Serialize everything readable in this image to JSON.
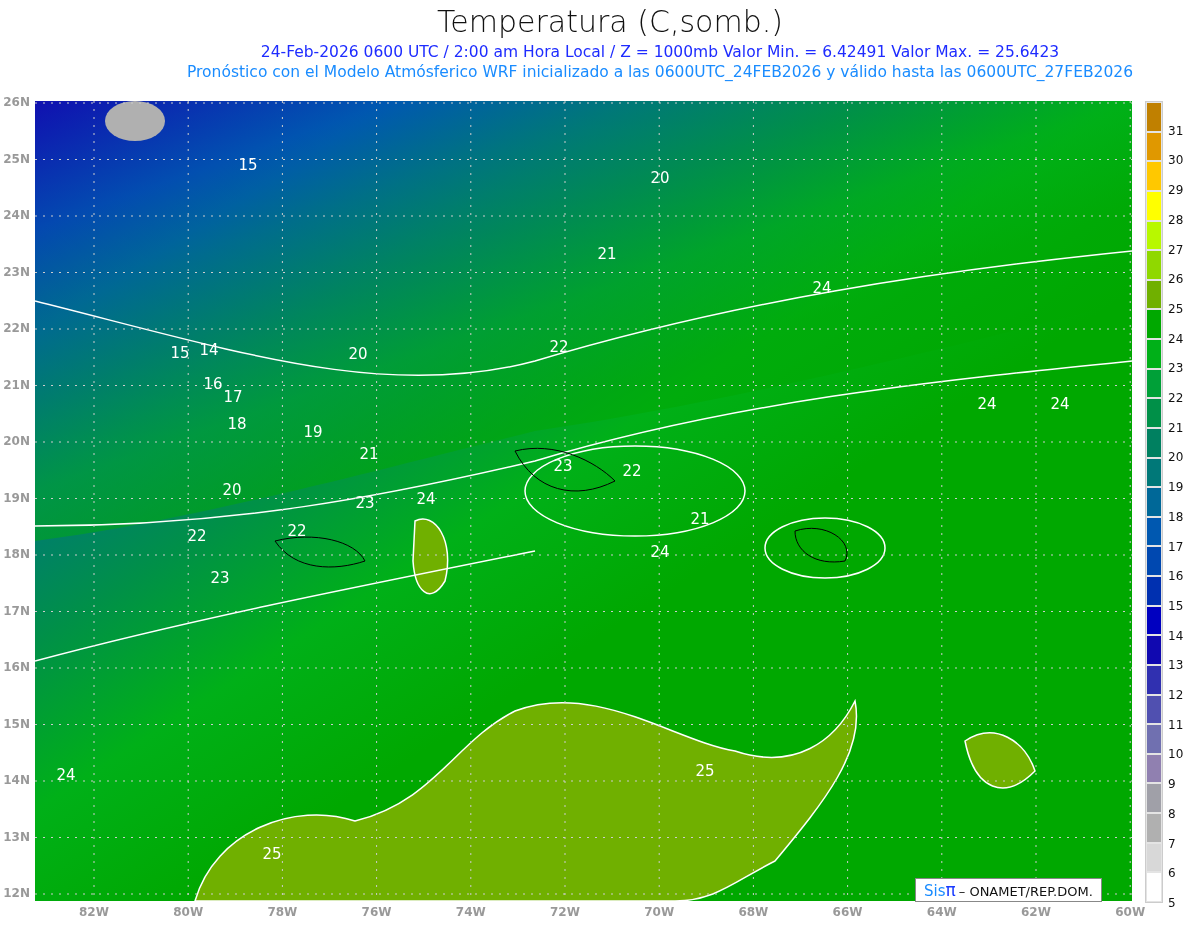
{
  "title": "Temperatura (C,somb.)",
  "subtitle": "24-Feb-2026  0600 UTC / 2:00 am Hora Local / Z = 1000mb   Valor Min. = 6.42491  Valor Max. = 25.6423",
  "forecast_note": "Pronóstico con el Modelo Atmósferico WRF inicializado a las 0600UTC_24FEB2026 y válido hasta las  0600UTC_27FEB2026",
  "latitude_labels": [
    "26N",
    "25N",
    "24N",
    "23N",
    "22N",
    "21N",
    "20N",
    "19N",
    "18N",
    "17N",
    "16N",
    "15N",
    "14N",
    "13N",
    "12N"
  ],
  "longitude_labels": [
    "82W",
    "80W",
    "78W",
    "76W",
    "74W",
    "72W",
    "70W",
    "68W",
    "66W",
    "64W",
    "62W",
    "60W"
  ],
  "contour_labels": [
    "15",
    "20",
    "21",
    "24",
    "15",
    "14",
    "20",
    "22",
    "16",
    "17",
    "18",
    "19",
    "21",
    "24",
    "24",
    "20",
    "23",
    "24",
    "23",
    "22",
    "21",
    "22",
    "22",
    "24",
    "23",
    "25",
    "24",
    "25"
  ],
  "colorbar": {
    "bins": [
      {
        "color": "#c08000"
      },
      {
        "color": "#e09800"
      },
      {
        "color": "#ffc800"
      },
      {
        "color": "#ffff00"
      },
      {
        "color": "#b8f800"
      },
      {
        "color": "#90d800"
      },
      {
        "color": "#70b000"
      },
      {
        "color": "#00a800"
      },
      {
        "color": "#00b018"
      },
      {
        "color": "#00a038"
      },
      {
        "color": "#009048"
      },
      {
        "color": "#008060"
      },
      {
        "color": "#007878"
      },
      {
        "color": "#006898"
      },
      {
        "color": "#0058b0"
      },
      {
        "color": "#0048b0"
      },
      {
        "color": "#0030b0"
      },
      {
        "color": "#0000c0"
      },
      {
        "color": "#1008b0"
      },
      {
        "color": "#3030b0"
      },
      {
        "color": "#5050b0"
      },
      {
        "color": "#7070b0"
      },
      {
        "color": "#9080b0"
      },
      {
        "color": "#a0a0a8"
      },
      {
        "color": "#b0b0b0"
      },
      {
        "color": "#d8d8d8"
      },
      {
        "color": "#ffffff"
      }
    ],
    "labels": [
      "31",
      "30",
      "29",
      "28",
      "27",
      "26",
      "25",
      "24",
      "23",
      "22",
      "21",
      "20",
      "19",
      "18",
      "17",
      "16",
      "15",
      "14",
      "13",
      "12",
      "11",
      "10",
      "9",
      "8",
      "7",
      "6",
      "5"
    ]
  },
  "credit": {
    "brand": "Sis",
    "symbol": "π",
    "text": "– ONAMET/REP.DOM."
  }
}
